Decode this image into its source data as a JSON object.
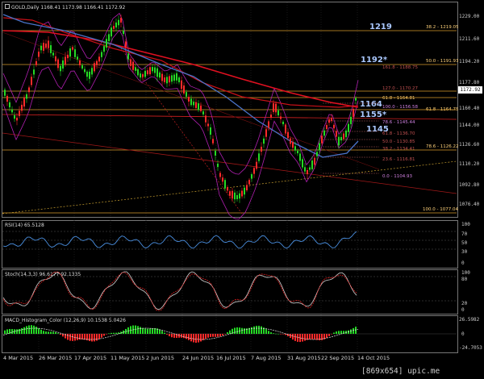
{
  "main_chart": {
    "header": "GOLD,Daily  1168.41 1173.98 1166.41 1172.92",
    "current_price": "1172.92",
    "price_ticks": [
      "1229.00",
      "1211.60",
      "1194.20",
      "1177.80",
      "1160.40",
      "1144.00",
      "1126.60",
      "1110.20",
      "1092.80",
      "1076.40"
    ],
    "fib_labels": [
      "38.2 - 1219.05",
      "50.0 - 1191.93",
      "161.8 - 1188.75",
      "127.0 - 1170.27",
      "61.8 - 1164.81",
      "100.0 - 1156.58",
      "61.8 - 1164.75",
      "78.6 - 1145.44",
      "61.8 - 1136.70",
      "50.0 - 1130.85",
      "38.2 - 1134.41",
      "78.6 - 1126.22",
      "23.6 - 1116.81",
      "0.0 - 1104.93",
      "100.0 - 1077.04"
    ],
    "level_labels": [
      "1219",
      "1192*",
      "1164",
      "1155*",
      "1145"
    ]
  },
  "rsi": {
    "header": "RSI(14) 65.5128",
    "ticks": [
      "100",
      "70",
      "50",
      "30",
      "0"
    ]
  },
  "stoch": {
    "header": "Stoch(14,3,3) 96.6177 92.1335",
    "ticks": [
      "100",
      "80",
      "20",
      "0"
    ]
  },
  "macd": {
    "header": "MACD_Histogram_Color (12,26,9) 10.1538 5.0426",
    "ticks": [
      "26.5982",
      "0",
      "-24.7053"
    ]
  },
  "date_axis": [
    "4 Mar 2015",
    "26 Mar 2015",
    "17 Apr 2015",
    "11 May 2015",
    "2 Jun 2015",
    "24 Jun 2015",
    "16 Jul 2015",
    "7 Aug 2015",
    "31 Aug 2015",
    "22 Sep 2015",
    "14 Oct 2015"
  ],
  "watermark": "[869x654] upic.me",
  "colors": {
    "up": "#25d925",
    "down": "#ff2a2a",
    "fib": "#d99a2a",
    "ma_slow": "#e01020",
    "ma_mid": "#4a73c9",
    "bollinger": "#b01fb0"
  }
}
